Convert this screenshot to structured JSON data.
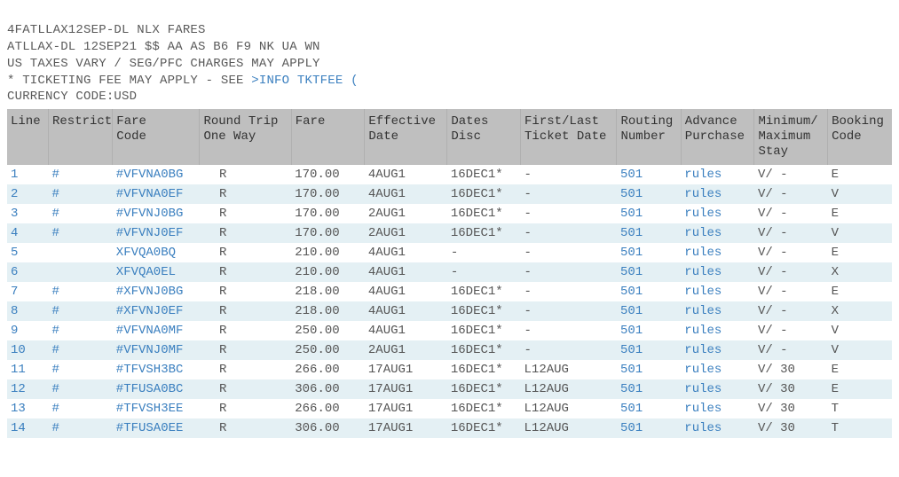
{
  "header": {
    "line1": "4FATLLAX12SEP-DL NLX FARES",
    "line2": "ATLLAX-DL 12SEP21 $$ AA AS B6 F9 NK UA WN",
    "line3": "US TAXES VARY / SEG/PFC CHARGES MAY APPLY",
    "line4_prefix": "* TICKETING FEE MAY APPLY - SEE ",
    "line4_link": ">INFO TKTFEE (",
    "line5": "CURRENCY CODE:USD"
  },
  "columns": [
    "Line",
    "Restrict",
    "Fare\nCode",
    "Round Trip\nOne Way",
    "Fare",
    "Effective\nDate",
    "Dates\nDisc",
    "First/Last\nTicket Date",
    "Routing\nNumber",
    "Advance\nPurchase",
    "Minimum/\nMaximum\nStay",
    "Booking\nCode"
  ],
  "rows": [
    {
      "line": "1",
      "restrict": "#",
      "farecode": "#VFVNA0BG",
      "rtow": "R",
      "fare": "170.00",
      "effdate": "4AUG1",
      "disc": "16DEC1*",
      "firstlast": "-",
      "routing": "501",
      "advance": "rules",
      "minmax": "V/ -",
      "booking": "E"
    },
    {
      "line": "2",
      "restrict": "#",
      "farecode": "#VFVNA0EF",
      "rtow": "R",
      "fare": "170.00",
      "effdate": "4AUG1",
      "disc": "16DEC1*",
      "firstlast": "-",
      "routing": "501",
      "advance": "rules",
      "minmax": "V/ -",
      "booking": "V"
    },
    {
      "line": "3",
      "restrict": "#",
      "farecode": "#VFVNJ0BG",
      "rtow": "R",
      "fare": "170.00",
      "effdate": "2AUG1",
      "disc": "16DEC1*",
      "firstlast": "-",
      "routing": "501",
      "advance": "rules",
      "minmax": "V/ -",
      "booking": "E"
    },
    {
      "line": "4",
      "restrict": "#",
      "farecode": "#VFVNJ0EF",
      "rtow": "R",
      "fare": "170.00",
      "effdate": "2AUG1",
      "disc": "16DEC1*",
      "firstlast": "-",
      "routing": "501",
      "advance": "rules",
      "minmax": "V/ -",
      "booking": "V"
    },
    {
      "line": "5",
      "restrict": "",
      "farecode": "XFVQA0BQ",
      "rtow": "R",
      "fare": "210.00",
      "effdate": "4AUG1",
      "disc": "-",
      "firstlast": "-",
      "routing": "501",
      "advance": "rules",
      "minmax": "V/ -",
      "booking": "E"
    },
    {
      "line": "6",
      "restrict": "",
      "farecode": "XFVQA0EL",
      "rtow": "R",
      "fare": "210.00",
      "effdate": "4AUG1",
      "disc": "-",
      "firstlast": "-",
      "routing": "501",
      "advance": "rules",
      "minmax": "V/ -",
      "booking": "X"
    },
    {
      "line": "7",
      "restrict": "#",
      "farecode": "#XFVNJ0BG",
      "rtow": "R",
      "fare": "218.00",
      "effdate": "4AUG1",
      "disc": "16DEC1*",
      "firstlast": "-",
      "routing": "501",
      "advance": "rules",
      "minmax": "V/ -",
      "booking": "E"
    },
    {
      "line": "8",
      "restrict": "#",
      "farecode": "#XFVNJ0EF",
      "rtow": "R",
      "fare": "218.00",
      "effdate": "4AUG1",
      "disc": "16DEC1*",
      "firstlast": "-",
      "routing": "501",
      "advance": "rules",
      "minmax": "V/ -",
      "booking": "X"
    },
    {
      "line": "9",
      "restrict": "#",
      "farecode": "#VFVNA0MF",
      "rtow": "R",
      "fare": "250.00",
      "effdate": "4AUG1",
      "disc": "16DEC1*",
      "firstlast": "-",
      "routing": "501",
      "advance": "rules",
      "minmax": "V/ -",
      "booking": "V"
    },
    {
      "line": "10",
      "restrict": "#",
      "farecode": "#VFVNJ0MF",
      "rtow": "R",
      "fare": "250.00",
      "effdate": "2AUG1",
      "disc": "16DEC1*",
      "firstlast": "-",
      "routing": "501",
      "advance": "rules",
      "minmax": "V/ -",
      "booking": "V"
    },
    {
      "line": "11",
      "restrict": "#",
      "farecode": "#TFVSH3BC",
      "rtow": "R",
      "fare": "266.00",
      "effdate": "17AUG1",
      "disc": "16DEC1*",
      "firstlast": "L12AUG",
      "routing": "501",
      "advance": "rules",
      "minmax": "V/ 30",
      "booking": "E"
    },
    {
      "line": "12",
      "restrict": "#",
      "farecode": "#TFUSA0BC",
      "rtow": "R",
      "fare": "306.00",
      "effdate": "17AUG1",
      "disc": "16DEC1*",
      "firstlast": "L12AUG",
      "routing": "501",
      "advance": "rules",
      "minmax": "V/ 30",
      "booking": "E"
    },
    {
      "line": "13",
      "restrict": "#",
      "farecode": "#TFVSH3EE",
      "rtow": "R",
      "fare": "266.00",
      "effdate": "17AUG1",
      "disc": "16DEC1*",
      "firstlast": "L12AUG",
      "routing": "501",
      "advance": "rules",
      "minmax": "V/ 30",
      "booking": "T"
    },
    {
      "line": "14",
      "restrict": "#",
      "farecode": "#TFUSA0EE",
      "rtow": "R",
      "fare": "306.00",
      "effdate": "17AUG1",
      "disc": "16DEC1*",
      "firstlast": "L12AUG",
      "routing": "501",
      "advance": "rules",
      "minmax": "V/ 30",
      "booking": "T"
    }
  ]
}
